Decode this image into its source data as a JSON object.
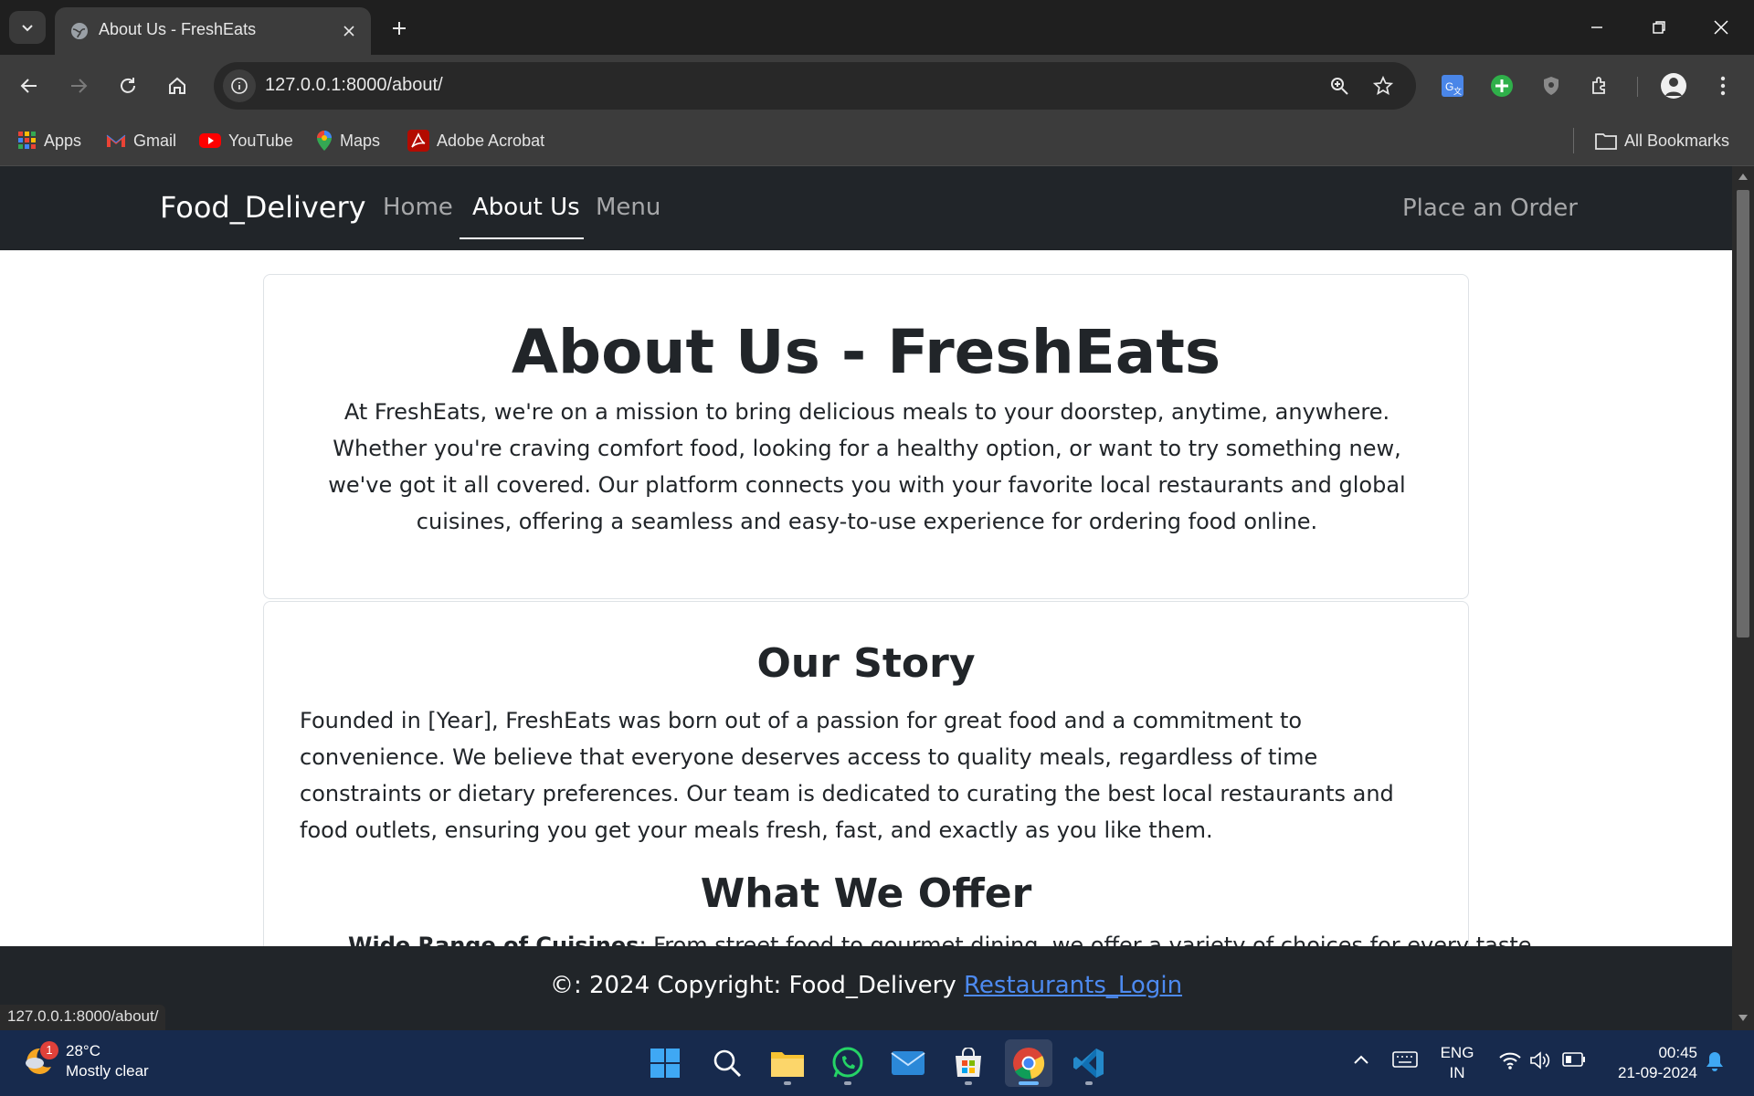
{
  "browser": {
    "tab_title": "About Us - FreshEats",
    "url": "127.0.0.1:8000/about/",
    "bookmarks": [
      "Apps",
      "Gmail",
      "YouTube",
      "Maps",
      "Adobe Acrobat"
    ],
    "all_bookmarks": "All Bookmarks",
    "status_url": "127.0.0.1:8000/about/"
  },
  "site": {
    "brand": "Food_Delivery",
    "nav": [
      "Home",
      "About Us",
      "Menu"
    ],
    "active_nav": "About Us",
    "order_link": "Place an Order"
  },
  "about": {
    "title": "About Us - FreshEats",
    "intro": "At FreshEats, we're on a mission to bring delicious meals to your doorstep, anytime, anywhere. Whether you're craving comfort food, looking for a healthy option, or want to try something new, we've got it all covered. Our platform connects you with your favorite local restaurants and global cuisines, offering a seamless and easy-to-use experience for ordering food online."
  },
  "story": {
    "heading": "Our Story",
    "text": "Founded in [Year], FreshEats was born out of a passion for great food and a commitment to convenience. We believe that everyone deserves access to quality meals, regardless of time constraints or dietary preferences. Our team is dedicated to curating the best local restaurants and food outlets, ensuring you get your meals fresh, fast, and exactly as you like them.",
    "offer_heading": "What We Offer",
    "offer_first_bold": "Wide Range of Cuisines",
    "offer_first_text": ": From street food to gourmet dining, we offer a variety of choices for every taste."
  },
  "footer": {
    "copyright": "©: 2024 Copyright: Food_Delivery",
    "link": "Restaurants_Login"
  },
  "taskbar": {
    "weather_temp": "28°C",
    "weather_desc": "Mostly clear",
    "weather_badge": "1",
    "lang_1": "ENG",
    "lang_2": "IN",
    "time": "00:45",
    "date": "21-09-2024"
  },
  "colors": {
    "navbar": "#212529",
    "link": "#4d8af0",
    "taskbar": "#172a4d"
  }
}
